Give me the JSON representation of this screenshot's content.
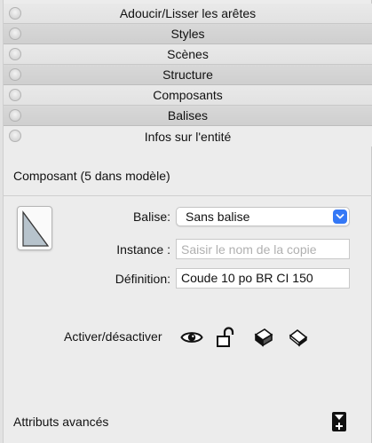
{
  "trays": [
    {
      "label": "Adoucir/Lisser les arêtes",
      "style": "light"
    },
    {
      "label": "Styles",
      "style": "dark"
    },
    {
      "label": "Scènes",
      "style": "light"
    },
    {
      "label": "Structure",
      "style": "dark"
    },
    {
      "label": "Composants",
      "style": "light"
    },
    {
      "label": "Balises",
      "style": "dark"
    },
    {
      "label": "Infos sur l'entité",
      "style": "light"
    }
  ],
  "entity": {
    "title": "Composant (5 dans modèle)",
    "tag_label": "Balise:",
    "tag_value": "Sans balise",
    "instance_label": "Instance :",
    "instance_placeholder": "Saisir le nom de la copie",
    "instance_value": "",
    "definition_label": "Définition:",
    "definition_value": "Coude 10 po BR CI 150",
    "toggle_label": "Activer/désactiver",
    "toggle_icons": [
      "eye-icon",
      "lock-open-icon",
      "cast-shadows-icon",
      "receive-shadows-icon"
    ],
    "advanced_label": "Attributs avancés"
  },
  "colors": {
    "accent": "#3478f6",
    "panel_bg": "#ececec",
    "tray_dark": "#d3d3d3",
    "tray_light": "#e6e6e6"
  }
}
